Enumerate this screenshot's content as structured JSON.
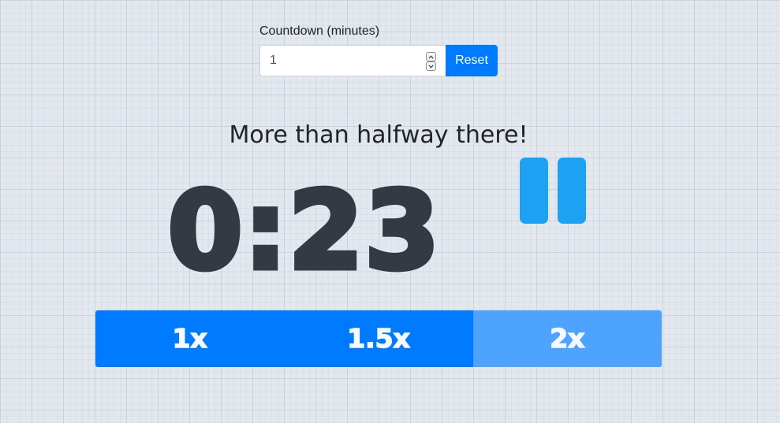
{
  "countdown": {
    "label": "Countdown (minutes)",
    "value": "1",
    "reset_label": "Reset"
  },
  "status_message": "More than halfway there!",
  "timer": {
    "display": "0:23",
    "state": "running"
  },
  "pause_control": {
    "icon": "pause-icon",
    "color": "#1da1f2"
  },
  "speed": {
    "options": [
      "1x",
      "1.5x",
      "2x"
    ],
    "selected": "2x"
  },
  "colors": {
    "primary": "#007bff",
    "selected_speed": "#4da3ff",
    "timer_text": "#343a44"
  }
}
